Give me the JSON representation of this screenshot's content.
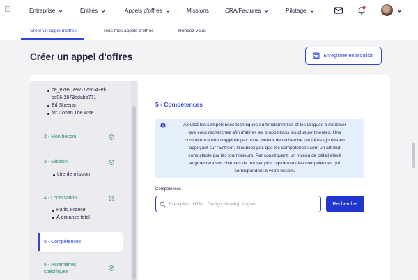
{
  "nav": {
    "items": [
      {
        "label": "Entreprise",
        "has_dropdown": true
      },
      {
        "label": "Entités",
        "has_dropdown": true
      },
      {
        "label": "Appels d'offres",
        "has_dropdown": true
      },
      {
        "label": "Missions",
        "has_dropdown": false
      },
      {
        "label": "CRA/Factures",
        "has_dropdown": true
      },
      {
        "label": "Pilotage",
        "has_dropdown": true
      }
    ],
    "icons": [
      "mail-icon",
      "bell-icon",
      "avatar",
      "chevron-down-icon"
    ],
    "notification_color": "#e0344f"
  },
  "subnav": {
    "tabs": [
      {
        "label": "Créer un appel d'offres",
        "active": true
      },
      {
        "label": "Tous mes appels d'offres",
        "active": false
      },
      {
        "label": "Rendez-vous",
        "active": false
      }
    ]
  },
  "page": {
    "title": "Créer un appel d'offres",
    "draft_button": "Enregistrer en brouillon"
  },
  "steps": {
    "top_details": [
      "be_e7891e97-775c-43ef-",
      "bc06-2979ddabb771",
      "Ed Sheeran",
      "Mr Conan The wise"
    ],
    "items": [
      {
        "label": "2 - Mon besoin",
        "done": true,
        "details": []
      },
      {
        "label": "3 - Mission",
        "done": true,
        "details": [
          "titre de mission"
        ]
      },
      {
        "label": "4 - Localisation",
        "done": true,
        "details": [
          "Paris, France",
          "À distance total"
        ]
      },
      {
        "label": "5 - Compétences",
        "done": false,
        "active": true,
        "details": []
      },
      {
        "label": "6 - Paramètres",
        "label2": "spécifiques",
        "done": true,
        "details": []
      }
    ]
  },
  "section": {
    "title": "5 - Compétences",
    "info_lines": [
      "Ajoutez les compétences techniques ou fonctionnelles et les langues à maîtriser",
      "que vous recherchez afin d'attirer les propositions les plus pertinentes. Une",
      "compétence non suggérée par notre moteur de recherche peut être ajoutée en",
      "appuyant sur \"Entrée\". N'oubliez pas que les compétences sont un attribut",
      "consultable par les fournisseurs. Par conséquent, un niveau de détail élevé",
      "augmentera vos chances de trouver plus rapidement les compétences qui",
      "correspondent à votre besoin."
    ],
    "field_label": "Compétences",
    "search_placeholder": "Exemples : HTML, Design thinking, Anglais...",
    "search_button": "Rechercher"
  },
  "colors": {
    "accent": "#2f45d8",
    "done_green": "#2f8a6a",
    "info_bg": "#e5eefb"
  }
}
